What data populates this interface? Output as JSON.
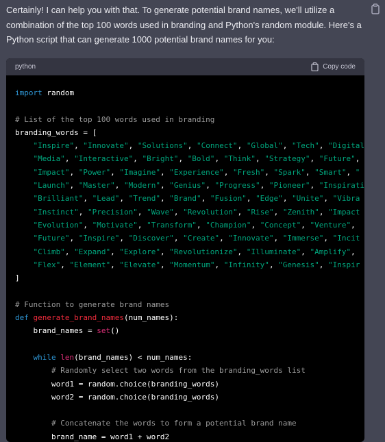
{
  "message": {
    "intro": "Certainly! I can help you with that. To generate potential brand names, we'll utilize a combination of the top 100 words used in branding and Python's random module. Here's a Python script that can generate 1000 potential brand names for you:",
    "copy_icon": "clipboard-icon"
  },
  "code_block": {
    "language": "python",
    "copy_label": "Copy code",
    "copy_icon": "clipboard-icon",
    "lines": [
      [
        [
          "kw",
          "import"
        ],
        [
          "pl",
          " random"
        ]
      ],
      [],
      [
        [
          "cm",
          "# List of the top 100 words used in branding"
        ]
      ],
      [
        [
          "pl",
          "branding_words = ["
        ]
      ],
      [
        [
          "pl",
          "    "
        ],
        [
          "st",
          "\"Inspire\""
        ],
        [
          "pl",
          ", "
        ],
        [
          "st",
          "\"Innovate\""
        ],
        [
          "pl",
          ", "
        ],
        [
          "st",
          "\"Solutions\""
        ],
        [
          "pl",
          ", "
        ],
        [
          "st",
          "\"Connect\""
        ],
        [
          "pl",
          ", "
        ],
        [
          "st",
          "\"Global\""
        ],
        [
          "pl",
          ", "
        ],
        [
          "st",
          "\"Tech\""
        ],
        [
          "pl",
          ", "
        ],
        [
          "st",
          "\"Digital\""
        ]
      ],
      [
        [
          "pl",
          "    "
        ],
        [
          "st",
          "\"Media\""
        ],
        [
          "pl",
          ", "
        ],
        [
          "st",
          "\"Interactive\""
        ],
        [
          "pl",
          ", "
        ],
        [
          "st",
          "\"Bright\""
        ],
        [
          "pl",
          ", "
        ],
        [
          "st",
          "\"Bold\""
        ],
        [
          "pl",
          ", "
        ],
        [
          "st",
          "\"Think\""
        ],
        [
          "pl",
          ", "
        ],
        [
          "st",
          "\"Strategy\""
        ],
        [
          "pl",
          ", "
        ],
        [
          "st",
          "\"Future\""
        ],
        [
          "pl",
          ","
        ]
      ],
      [
        [
          "pl",
          "    "
        ],
        [
          "st",
          "\"Impact\""
        ],
        [
          "pl",
          ", "
        ],
        [
          "st",
          "\"Power\""
        ],
        [
          "pl",
          ", "
        ],
        [
          "st",
          "\"Imagine\""
        ],
        [
          "pl",
          ", "
        ],
        [
          "st",
          "\"Experience\""
        ],
        [
          "pl",
          ", "
        ],
        [
          "st",
          "\"Fresh\""
        ],
        [
          "pl",
          ", "
        ],
        [
          "st",
          "\"Spark\""
        ],
        [
          "pl",
          ", "
        ],
        [
          "st",
          "\"Smart\""
        ],
        [
          "pl",
          ", "
        ],
        [
          "st",
          "\""
        ]
      ],
      [
        [
          "pl",
          "    "
        ],
        [
          "st",
          "\"Launch\""
        ],
        [
          "pl",
          ", "
        ],
        [
          "st",
          "\"Master\""
        ],
        [
          "pl",
          ", "
        ],
        [
          "st",
          "\"Modern\""
        ],
        [
          "pl",
          ", "
        ],
        [
          "st",
          "\"Genius\""
        ],
        [
          "pl",
          ", "
        ],
        [
          "st",
          "\"Progress\""
        ],
        [
          "pl",
          ", "
        ],
        [
          "st",
          "\"Pioneer\""
        ],
        [
          "pl",
          ", "
        ],
        [
          "st",
          "\"Inspirati"
        ]
      ],
      [
        [
          "pl",
          "    "
        ],
        [
          "st",
          "\"Brilliant\""
        ],
        [
          "pl",
          ", "
        ],
        [
          "st",
          "\"Lead\""
        ],
        [
          "pl",
          ", "
        ],
        [
          "st",
          "\"Trend\""
        ],
        [
          "pl",
          ", "
        ],
        [
          "st",
          "\"Brand\""
        ],
        [
          "pl",
          ", "
        ],
        [
          "st",
          "\"Fusion\""
        ],
        [
          "pl",
          ", "
        ],
        [
          "st",
          "\"Edge\""
        ],
        [
          "pl",
          ", "
        ],
        [
          "st",
          "\"Unite\""
        ],
        [
          "pl",
          ", "
        ],
        [
          "st",
          "\"Vibra"
        ]
      ],
      [
        [
          "pl",
          "    "
        ],
        [
          "st",
          "\"Instinct\""
        ],
        [
          "pl",
          ", "
        ],
        [
          "st",
          "\"Precision\""
        ],
        [
          "pl",
          ", "
        ],
        [
          "st",
          "\"Wave\""
        ],
        [
          "pl",
          ", "
        ],
        [
          "st",
          "\"Revolution\""
        ],
        [
          "pl",
          ", "
        ],
        [
          "st",
          "\"Rise\""
        ],
        [
          "pl",
          ", "
        ],
        [
          "st",
          "\"Zenith\""
        ],
        [
          "pl",
          ", "
        ],
        [
          "st",
          "\"Impact"
        ]
      ],
      [
        [
          "pl",
          "    "
        ],
        [
          "st",
          "\"Evolution\""
        ],
        [
          "pl",
          ", "
        ],
        [
          "st",
          "\"Motivate\""
        ],
        [
          "pl",
          ", "
        ],
        [
          "st",
          "\"Transform\""
        ],
        [
          "pl",
          ", "
        ],
        [
          "st",
          "\"Champion\""
        ],
        [
          "pl",
          ", "
        ],
        [
          "st",
          "\"Concept\""
        ],
        [
          "pl",
          ", "
        ],
        [
          "st",
          "\"Venture\""
        ],
        [
          "pl",
          ","
        ]
      ],
      [
        [
          "pl",
          "    "
        ],
        [
          "st",
          "\"Future\""
        ],
        [
          "pl",
          ", "
        ],
        [
          "st",
          "\"Inspire\""
        ],
        [
          "pl",
          ", "
        ],
        [
          "st",
          "\"Discover\""
        ],
        [
          "pl",
          ", "
        ],
        [
          "st",
          "\"Create\""
        ],
        [
          "pl",
          ", "
        ],
        [
          "st",
          "\"Innovate\""
        ],
        [
          "pl",
          ", "
        ],
        [
          "st",
          "\"Immerse\""
        ],
        [
          "pl",
          ", "
        ],
        [
          "st",
          "\"Incit"
        ]
      ],
      [
        [
          "pl",
          "    "
        ],
        [
          "st",
          "\"Climb\""
        ],
        [
          "pl",
          ", "
        ],
        [
          "st",
          "\"Expand\""
        ],
        [
          "pl",
          ", "
        ],
        [
          "st",
          "\"Explore\""
        ],
        [
          "pl",
          ", "
        ],
        [
          "st",
          "\"Revolutionize\""
        ],
        [
          "pl",
          ", "
        ],
        [
          "st",
          "\"Illuminate\""
        ],
        [
          "pl",
          ", "
        ],
        [
          "st",
          "\"Amplify\""
        ],
        [
          "pl",
          ","
        ]
      ],
      [
        [
          "pl",
          "    "
        ],
        [
          "st",
          "\"Flex\""
        ],
        [
          "pl",
          ", "
        ],
        [
          "st",
          "\"Element\""
        ],
        [
          "pl",
          ", "
        ],
        [
          "st",
          "\"Elevate\""
        ],
        [
          "pl",
          ", "
        ],
        [
          "st",
          "\"Momentum\""
        ],
        [
          "pl",
          ", "
        ],
        [
          "st",
          "\"Infinity\""
        ],
        [
          "pl",
          ", "
        ],
        [
          "st",
          "\"Genesis\""
        ],
        [
          "pl",
          ", "
        ],
        [
          "st",
          "\"Inspir"
        ]
      ],
      [
        [
          "pl",
          "]"
        ]
      ],
      [],
      [
        [
          "cm",
          "# Function to generate brand names"
        ]
      ],
      [
        [
          "kw",
          "def"
        ],
        [
          "pl",
          " "
        ],
        [
          "fn",
          "generate_brand_names"
        ],
        [
          "pl",
          "(num_names):"
        ]
      ],
      [
        [
          "pl",
          "    brand_names = "
        ],
        [
          "bi",
          "set"
        ],
        [
          "pl",
          "()"
        ]
      ],
      [],
      [
        [
          "pl",
          "    "
        ],
        [
          "kw",
          "while"
        ],
        [
          "pl",
          " "
        ],
        [
          "bi",
          "len"
        ],
        [
          "pl",
          "(brand_names) < num_names:"
        ]
      ],
      [
        [
          "pl",
          "        "
        ],
        [
          "cm",
          "# Randomly select two words from the branding_words list"
        ]
      ],
      [
        [
          "pl",
          "        word1 = random.choice(branding_words)"
        ]
      ],
      [
        [
          "pl",
          "        word2 = random.choice(branding_words)"
        ]
      ],
      [],
      [
        [
          "pl",
          "        "
        ],
        [
          "cm",
          "# Concatenate the words to form a potential brand name"
        ]
      ],
      [
        [
          "pl",
          "        brand_name = word1 + word2"
        ]
      ]
    ]
  },
  "colors": {
    "background": "#444654",
    "code_background": "#000000",
    "code_header": "#343541",
    "keyword": "#2e95d3",
    "function": "#f22c3d",
    "builtin": "#df3079",
    "comment": "#9c9c9c",
    "string": "#00a67d"
  }
}
